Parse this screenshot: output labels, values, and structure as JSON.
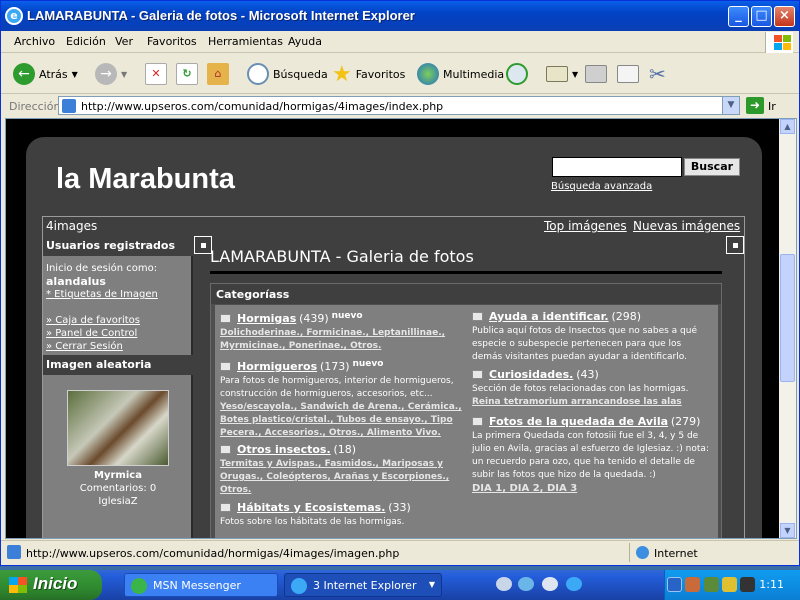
{
  "window": {
    "title": "LAMARABUNTA - Galeria de fotos - Microsoft Internet Explorer"
  },
  "menu": [
    "Archivo",
    "Edición",
    "Ver",
    "Favoritos",
    "Herramientas",
    "Ayuda"
  ],
  "toolbar": {
    "back": "Atrás",
    "search": "Búsqueda",
    "favorites": "Favoritos",
    "media": "Multimedia"
  },
  "address": {
    "label": "Dirección",
    "url": "http://www.upseros.com/comunidad/hormigas/4images/index.php",
    "go": "Ir"
  },
  "site": {
    "logo": "la Marabunta",
    "search_button": "Buscar",
    "advanced_search": "Búsqueda avanzada",
    "brand": "4images",
    "top_images": "Top imágenes",
    "new_images": "Nuevas imágenes"
  },
  "sidebar": {
    "users_header": "Usuarios registrados",
    "login_as": "Inicio de sesión como:",
    "username": "alandalus",
    "tags_link": "* Etiquetas de Imagen",
    "links": [
      "» Caja de favoritos",
      "» Panel de Control",
      "» Cerrar Sesión"
    ],
    "random_header": "Imagen aleatoria",
    "random_name": "Myrmica",
    "random_comments": "Comentarios: 0",
    "random_user": "IglesiaZ"
  },
  "main": {
    "title": "LAMARABUNTA - Galeria de fotos",
    "categories_header": "Categoríass",
    "left": [
      {
        "name": "Hormigas",
        "count": "(439)",
        "nuevo": "nuevo",
        "desc": "",
        "subs": "Dolichoderinae., Formicinae., Leptanillinae., Myrmicinae., Ponerinae., Otros."
      },
      {
        "name": "Hormigueros",
        "count": "(173)",
        "nuevo": "nuevo",
        "desc": "Para fotos de hormigueros, interior de hormigueros, construcción de hormigueros, accesorios, etc...",
        "subs": "Yeso/escayola., Sandwich de Arena., Cerámica., Botes plastico/cristal., Tubos de ensayo., Tipo Pecera., Accesorios., Otros., Alimento Vivo."
      },
      {
        "name": "Otros insectos.",
        "count": "(18)",
        "nuevo": "",
        "desc": "",
        "subs": "Termitas y Avispas., Fasmidos., Mariposas y Orugas., Coleópteros, Arañas y Escorpiones., Otros."
      },
      {
        "name": "Hábitats y Ecosistemas.",
        "count": "(33)",
        "nuevo": "",
        "desc": "Fotos sobre los hábitats de las hormigas.",
        "subs": ""
      }
    ],
    "right": [
      {
        "name": "Ayuda a identificar.",
        "count": "(298)",
        "desc": "Publica aquí fotos de Insectos que no sabes a qué especie o subespecie pertenecen para que los demás visitantes puedan ayudar a identificarlo.",
        "subs": ""
      },
      {
        "name": "Curiosidades.",
        "count": "(43)",
        "desc": "Sección de fotos relacionadas con las hormigas.",
        "subs": "Reina tetramorium arrancandose las alas"
      },
      {
        "name": "Fotos de la quedada de Avila",
        "count": "(279)",
        "desc": "La primera Quedada con fotosiii fue el 3, 4, y 5 de julio en Avila, gracias al esfuerzo de Iglesiaz. :) nota: un recuerdo para ozo, que ha tenido el detalle de subir las fotos que hizo de la quedada. :)",
        "subs": "DIA 1, DIA 2, DIA 3"
      }
    ]
  },
  "status": {
    "url": "http://www.upseros.com/comunidad/hormigas/4images/imagen.php",
    "zone": "Internet"
  },
  "taskbar": {
    "start": "Inicio",
    "tasks": [
      "MSN Messenger",
      "3 Internet Explorer"
    ],
    "clock": "1:11"
  }
}
